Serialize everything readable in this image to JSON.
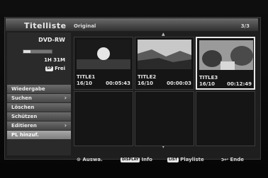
{
  "header": {
    "title": "Titelliste",
    "subtitle": "Original",
    "page": "3/3"
  },
  "disc": {
    "type": "DVD-RW",
    "time": "1H 31M",
    "mode": "SP",
    "free_label": "Frei",
    "used_fraction": 0.25
  },
  "menu": {
    "items": [
      {
        "label": "Wiedergabe",
        "arrow": ""
      },
      {
        "label": "Suchen",
        "arrow": "›"
      },
      {
        "label": "Löschen",
        "arrow": ""
      },
      {
        "label": "Schützen",
        "arrow": ""
      },
      {
        "label": "Editieren",
        "arrow": "›"
      },
      {
        "label": "PL hinzuf.",
        "arrow": ""
      }
    ]
  },
  "titles": [
    {
      "name": "TITLE1",
      "date": "16/10",
      "duration": "00:05:43"
    },
    {
      "name": "TITLE2",
      "date": "16/10",
      "duration": "00:00:03"
    },
    {
      "name": "TITLE3",
      "date": "16/10",
      "duration": "00:12:49"
    }
  ],
  "footer": {
    "select_icon": "⊙",
    "select": "Auswa.",
    "info_key": "DISPLAY",
    "info": "Info",
    "list_key": "LIST",
    "list": "Playliste",
    "exit_icon": "ↄ↩",
    "exit": "Ende"
  },
  "arrows": {
    "up": "▲",
    "down": "▼"
  }
}
